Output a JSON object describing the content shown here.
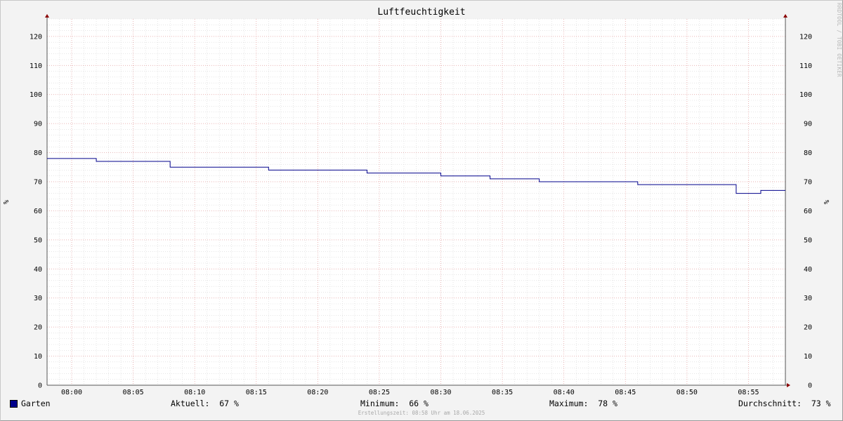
{
  "chart_data": {
    "type": "line",
    "title": "Luftfeuchtigkeit",
    "ylabel_left": "%",
    "ylabel_right": "%",
    "ylim": [
      0,
      126
    ],
    "y_ticks": [
      0,
      10,
      20,
      30,
      40,
      50,
      60,
      70,
      80,
      90,
      100,
      110,
      120
    ],
    "x_range": [
      "07:58",
      "08:58"
    ],
    "x_ticks": [
      "08:00",
      "08:05",
      "08:10",
      "08:15",
      "08:20",
      "08:25",
      "08:30",
      "08:35",
      "08:40",
      "08:45",
      "08:50",
      "08:55"
    ],
    "grid": true,
    "legend_position": "bottom-left",
    "series": [
      {
        "name": "Garten",
        "color": "#00008b",
        "step": true,
        "points": [
          {
            "time": "07:58",
            "value": 78
          },
          {
            "time": "08:02",
            "value": 77
          },
          {
            "time": "08:08",
            "value": 75
          },
          {
            "time": "08:16",
            "value": 74
          },
          {
            "time": "08:24",
            "value": 73
          },
          {
            "time": "08:30",
            "value": 72
          },
          {
            "time": "08:34",
            "value": 71
          },
          {
            "time": "08:38",
            "value": 70
          },
          {
            "time": "08:46",
            "value": 69
          },
          {
            "time": "08:54",
            "value": 66
          },
          {
            "time": "08:56",
            "value": 67
          },
          {
            "time": "08:58",
            "value": 67
          }
        ]
      }
    ]
  },
  "legend": {
    "series_name": "Garten",
    "current": "Aktuell:  67 %",
    "minimum": "Minimum:  66 %",
    "maximum": "Maximum:  78 %",
    "average": "Durchschnitt:  73 %"
  },
  "watermark": "RRDTOOL / TOBI OETIKER",
  "footer": "Erstellungszeit: 08:58 Uhr am 18.06.2025"
}
